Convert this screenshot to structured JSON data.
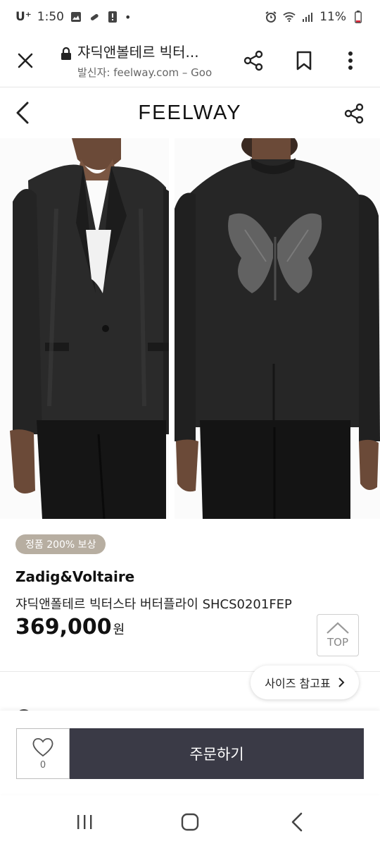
{
  "status_bar": {
    "carrier": "U⁺",
    "time": "1:50",
    "battery": "11%"
  },
  "custom_tab": {
    "title": "쟈딕앤볼테르 빅터...",
    "subtitle": "발신자: feelway.com – Goo"
  },
  "site": {
    "logo": "FEELWAY"
  },
  "product": {
    "badge": "정품 200% 보상",
    "brand": "Zadig&Voltaire",
    "name": "쟈딕앤폴테르 빅터스타 버터플라이 SHCS0201FEP",
    "price": "369,000",
    "currency": "원"
  },
  "top_button": {
    "label": "TOP"
  },
  "size_guide": {
    "label": "사이즈 참고표"
  },
  "action_bar": {
    "like_count": "0",
    "order_label": "주문하기"
  },
  "colors": {
    "badge_bg": "#b7aea1",
    "order_bg": "#3a3a46"
  }
}
